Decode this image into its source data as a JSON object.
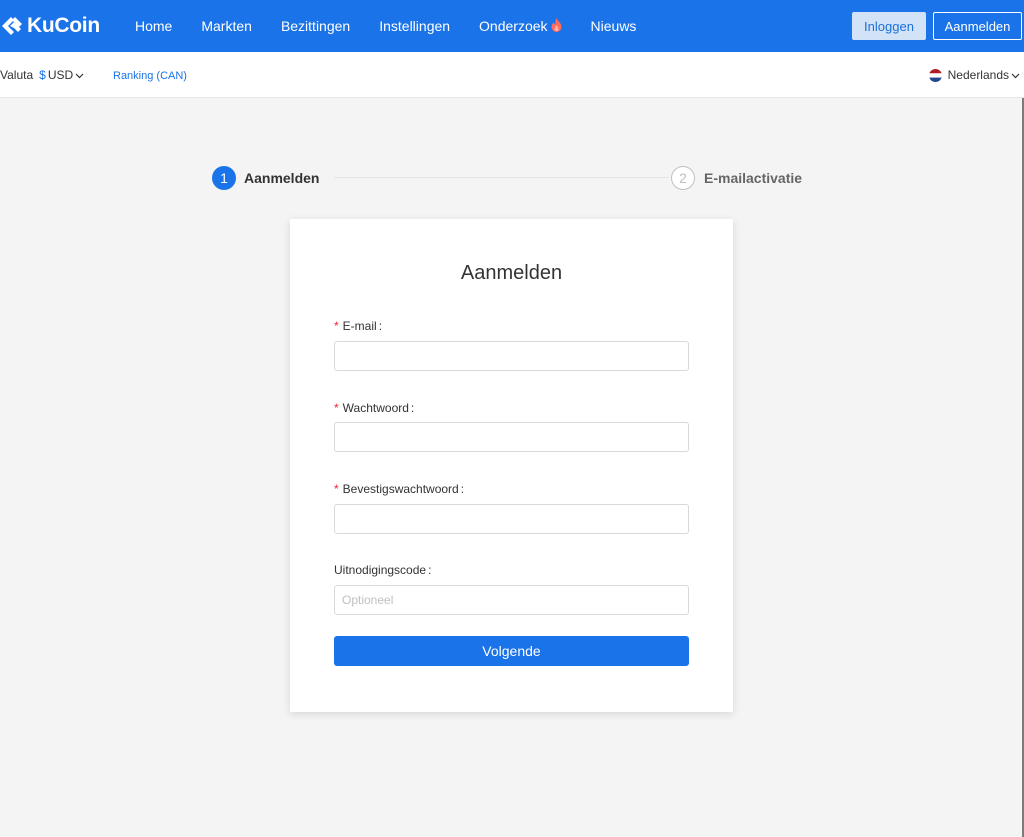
{
  "brand": {
    "name": "KuCoin",
    "color": "#1a73e8"
  },
  "nav": {
    "items": [
      {
        "label": "Home"
      },
      {
        "label": "Markten"
      },
      {
        "label": "Bezittingen"
      },
      {
        "label": "Instellingen"
      },
      {
        "label": "Onderzoek",
        "icon": "fire-icon"
      },
      {
        "label": "Nieuws"
      }
    ],
    "login_label": "Inloggen",
    "register_label": "Aanmelden"
  },
  "subbar": {
    "currency_label": "Valuta",
    "currency_symbol": "$",
    "currency_code": "USD",
    "ranking_label": "Ranking (CAN)",
    "language_label": "Nederlands"
  },
  "steps": [
    {
      "number": "1",
      "label": "Aanmelden",
      "active": true
    },
    {
      "number": "2",
      "label": "E-mailactivatie",
      "active": false
    }
  ],
  "form": {
    "title": "Aanmelden",
    "fields": {
      "email": {
        "label": "E-mail",
        "required": true,
        "value": "",
        "placeholder": ""
      },
      "password": {
        "label": "Wachtwoord",
        "required": true,
        "value": "",
        "placeholder": ""
      },
      "confirm": {
        "label": "Bevestigswachtwoord",
        "required": true,
        "value": "",
        "placeholder": ""
      },
      "invite": {
        "label": "Uitnodigingscode",
        "required": false,
        "value": "",
        "placeholder": "Optioneel"
      }
    },
    "colon": ":",
    "required_mark": "*",
    "submit_label": "Volgende"
  }
}
